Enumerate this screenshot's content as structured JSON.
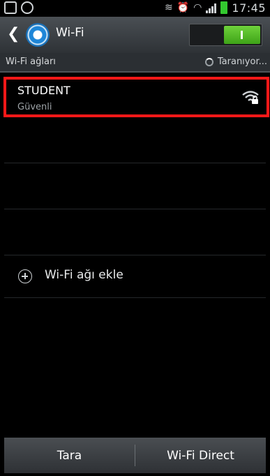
{
  "status_bar": {
    "time": "17:45",
    "left_icons": [
      "gallery-notification-icon",
      "whatsapp-notification-icon"
    ],
    "right_icons": [
      "nfc-icon",
      "alarm-icon",
      "wifi-status-icon",
      "signal-icon",
      "battery-icon"
    ],
    "battery_color": "#33c82f"
  },
  "action_bar": {
    "back_icon": "chevron-left-icon",
    "app_icon": "settings-gear-icon",
    "title": "Wi-Fi",
    "toggle_on": true,
    "toggle_accent": "#4dbb22"
  },
  "section": {
    "label": "Wi-Fi ağları",
    "scan_status": "Taranıyor..."
  },
  "networks": [
    {
      "ssid": "STUDENT",
      "status": "Güvenli",
      "icon": "wifi-locked-icon",
      "highlight_color": "#ff1818"
    }
  ],
  "add_network": {
    "label": "Wi-Fi ağı ekle",
    "icon": "plus-circle-icon"
  },
  "bottom_bar": {
    "scan_label": "Tara",
    "direct_label": "Wi-Fi Direct"
  }
}
